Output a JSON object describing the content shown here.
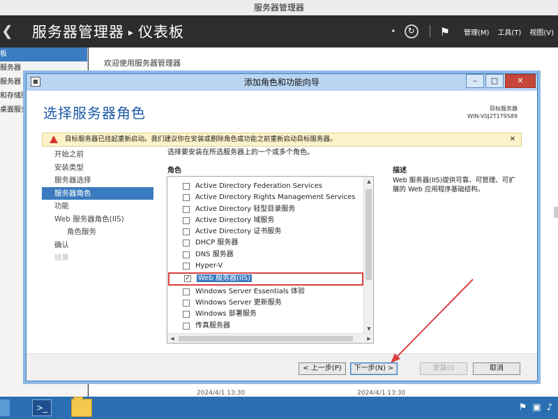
{
  "window": {
    "title": "服务器管理器"
  },
  "header": {
    "app": "服务器管理器",
    "page": "仪表板",
    "menus": [
      "管理(M)",
      "工具(T)",
      "视图(V)"
    ]
  },
  "sidebar": {
    "items": [
      "板",
      "服务器",
      "服务器",
      "和存储服",
      "桌面服务"
    ]
  },
  "main": {
    "welcome": "欢迎使用服务器管理器",
    "timestamps": [
      "2024/4/1 13:30",
      "2024/4/1 13:30"
    ]
  },
  "wizard": {
    "title": "添加角色和功能向导",
    "heading": "选择服务器角色",
    "target_label": "目标服务器",
    "target_name": "WIN-V0J2T1T9S89",
    "warning": "目标服务器已挂起重新启动。我们建议你在安装或删除角色或功能之前重新启动目标服务器。",
    "nav": [
      {
        "label": "开始之前",
        "state": "normal"
      },
      {
        "label": "安装类型",
        "state": "normal"
      },
      {
        "label": "服务器选择",
        "state": "normal"
      },
      {
        "label": "服务器角色",
        "state": "active"
      },
      {
        "label": "功能",
        "state": "normal"
      },
      {
        "label": "Web 服务器角色(IIS)",
        "state": "normal"
      },
      {
        "label": "角色服务",
        "state": "sub"
      },
      {
        "label": "确认",
        "state": "normal"
      },
      {
        "label": "结果",
        "state": "disabled"
      }
    ],
    "instruction": "选择要安装在所选服务器上的一个或多个角色。",
    "roles_label": "角色",
    "roles": [
      {
        "label": "Active Directory Federation Services",
        "checked": false
      },
      {
        "label": "Active Directory Rights Management Services",
        "checked": false
      },
      {
        "label": "Active Directory 轻型目录服务",
        "checked": false
      },
      {
        "label": "Active Directory 域服务",
        "checked": false
      },
      {
        "label": "Active Directory 证书服务",
        "checked": false
      },
      {
        "label": "DHCP 服务器",
        "checked": false
      },
      {
        "label": "DNS 服务器",
        "checked": false
      },
      {
        "label": "Hyper-V",
        "checked": false
      },
      {
        "label": "Web 服务器(IIS)",
        "checked": true,
        "selected": true
      },
      {
        "label": "Windows Server Essentials 体验",
        "checked": false
      },
      {
        "label": "Windows Server 更新服务",
        "checked": false
      },
      {
        "label": "Windows 部署服务",
        "checked": false
      },
      {
        "label": "传真服务器",
        "checked": false
      }
    ],
    "description_label": "描述",
    "description": "Web 服务器(IIS)提供可靠、可管理、可扩展的 Web 应用程序基础结构。",
    "buttons": {
      "prev": "< 上一步(P)",
      "next": "下一步(N) >",
      "install": "安装(I)",
      "cancel": "取消"
    }
  },
  "colors": {
    "accent": "#3b7bbf",
    "highlight_box": "#d94040",
    "warning_bg": "#fdf2c9"
  }
}
